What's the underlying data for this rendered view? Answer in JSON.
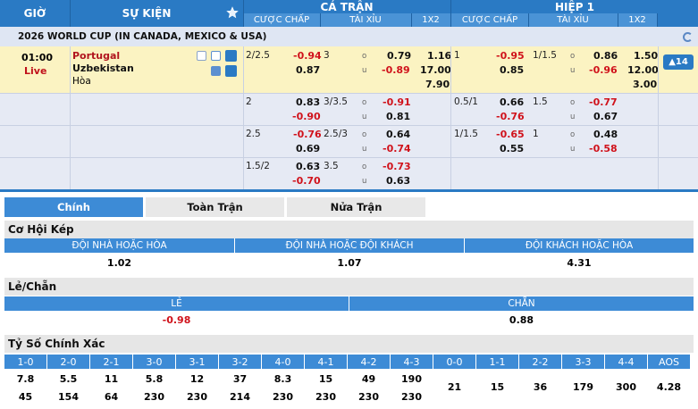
{
  "header": {
    "time_col": "GIỜ",
    "event_col": "SỰ KIỆN",
    "fulltime": "CẢ TRẬN",
    "half": "HIỆP 1",
    "handicap": "CƯỢC CHẤP",
    "overunder": "TÀI XỈU",
    "x12": "1X2",
    "handicap2": "CƯỢC CHẤP",
    "overunder2": "TÀI XỈU",
    "x12_2": "1X2"
  },
  "league": "2026 WORLD CUP (IN CANADA, MEXICO & USA)",
  "match": {
    "time": "01:00",
    "status": "Live",
    "home": "Portugal",
    "away": "Uzbekistan",
    "draw": "Hòa",
    "more": "▲14"
  },
  "odds_rows": [
    {
      "ft_hdp": "2/2.5",
      "ft_hdp_h": "-0.94",
      "ft_hdp_a": "0.87",
      "ft_ou": "3",
      "ft_o": "0.79",
      "ft_u": "-0.89",
      "ft_1": "1.16",
      "ft_2": "17.00",
      "ft_x": "7.90",
      "h1_hdp": "1",
      "h1_hdp_h": "-0.95",
      "h1_hdp_a": "0.85",
      "h1_ou": "1/1.5",
      "h1_o": "0.86",
      "h1_u": "-0.96",
      "h1_1": "1.50",
      "h1_2": "12.00",
      "h1_x": "3.00"
    },
    {
      "ft_hdp": "2",
      "ft_hdp_h": "0.83",
      "ft_hdp_a": "-0.90",
      "ft_ou": "3/3.5",
      "ft_o": "-0.91",
      "ft_u": "0.81",
      "h1_hdp": "0.5/1",
      "h1_hdp_h": "0.66",
      "h1_hdp_a": "-0.76",
      "h1_ou": "1.5",
      "h1_o": "-0.77",
      "h1_u": "0.67"
    },
    {
      "ft_hdp": "2.5",
      "ft_hdp_h": "-0.76",
      "ft_hdp_a": "0.69",
      "ft_ou": "2.5/3",
      "ft_o": "0.64",
      "ft_u": "-0.74",
      "h1_hdp": "1/1.5",
      "h1_hdp_h": "-0.65",
      "h1_hdp_a": "0.55",
      "h1_ou": "1",
      "h1_o": "0.48",
      "h1_u": "-0.58"
    },
    {
      "ft_hdp": "1.5/2",
      "ft_hdp_h": "0.63",
      "ft_hdp_a": "-0.70",
      "ft_ou": "3.5",
      "ft_o": "-0.73",
      "ft_u": "0.63"
    }
  ],
  "ou_labels": {
    "o": "o",
    "u": "u"
  },
  "tabs": [
    "Chính",
    "Toàn Trận",
    "Nửa Trận"
  ],
  "double_chance": {
    "title": "Cơ Hội Kép",
    "headers": [
      "ĐỘI NHÀ HOẶC HÒA",
      "ĐỘI NHÀ HOẶC ĐỘI KHÁCH",
      "ĐỘI KHÁCH HOẶC HÒA"
    ],
    "values": [
      "1.02",
      "1.07",
      "4.31"
    ]
  },
  "odd_even": {
    "title": "Lẻ/Chẵn",
    "headers": [
      "LẺ",
      "CHẴN"
    ],
    "values": [
      "-0.98",
      "0.88"
    ]
  },
  "correct_score": {
    "title": "Tỷ Số Chính Xác",
    "home_headers": [
      "1-0",
      "2-0",
      "2-1",
      "3-0",
      "3-1",
      "3-2",
      "4-0",
      "4-1",
      "4-2",
      "4-3"
    ],
    "home_values": [
      "7.8",
      "5.5",
      "11",
      "5.8",
      "12",
      "37",
      "8.3",
      "15",
      "49",
      "190"
    ],
    "away_values": [
      "45",
      "154",
      "64",
      "230",
      "230",
      "214",
      "230",
      "230",
      "230",
      "230"
    ],
    "draw_headers": [
      "0-0",
      "1-1",
      "2-2",
      "3-3",
      "4-4",
      "AOS"
    ],
    "draw_values": [
      "21",
      "15",
      "36",
      "179",
      "300",
      "4.28"
    ]
  }
}
